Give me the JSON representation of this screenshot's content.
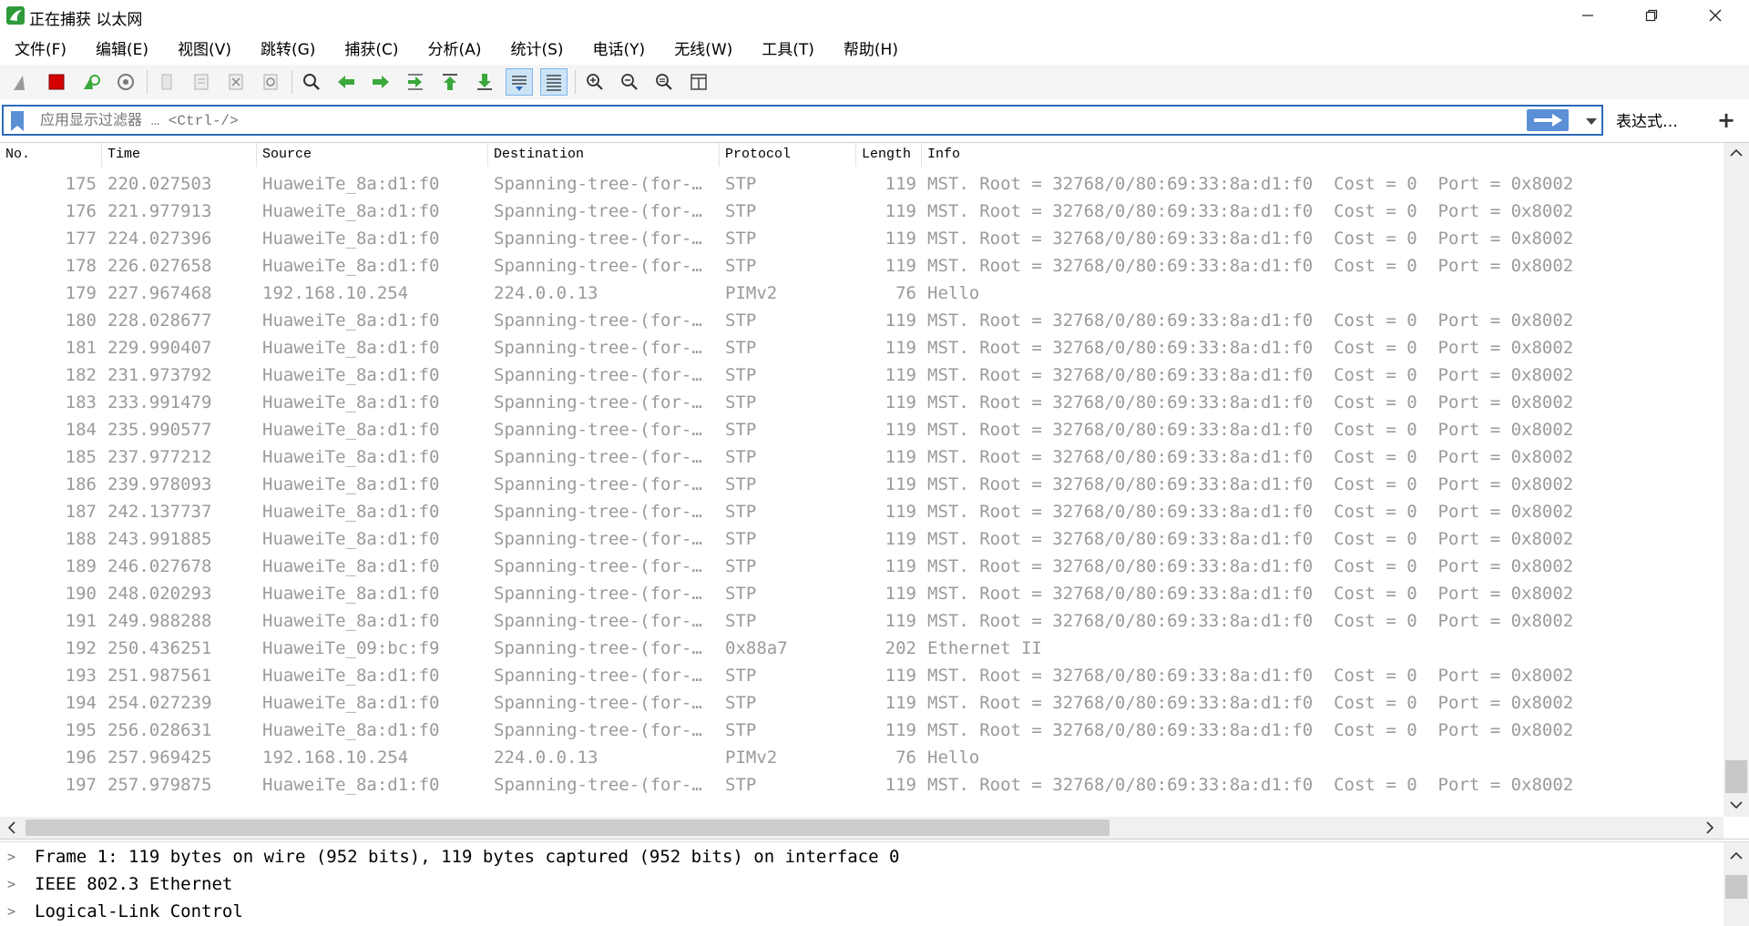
{
  "window": {
    "title": "正在捕获 以太网",
    "minimize_glyph": "—",
    "maximize_glyph": "❐",
    "close_glyph": "✕"
  },
  "menu": [
    {
      "label": "文件(F)"
    },
    {
      "label": "编辑(E)"
    },
    {
      "label": "视图(V)"
    },
    {
      "label": "跳转(G)"
    },
    {
      "label": "捕获(C)"
    },
    {
      "label": "分析(A)"
    },
    {
      "label": "统计(S)"
    },
    {
      "label": "电话(Y)"
    },
    {
      "label": "无线(W)"
    },
    {
      "label": "工具(T)"
    },
    {
      "label": "帮助(H)"
    }
  ],
  "toolbar": {
    "icons": [
      "shark-fin-icon",
      "stop-capture-icon",
      "restart-capture-icon",
      "capture-options-icon",
      "open-file-icon",
      "save-file-icon",
      "close-file-icon",
      "reload-file-icon",
      "find-packet-icon",
      "go-back-icon",
      "go-forward-icon",
      "go-to-packet-icon",
      "go-first-icon",
      "go-last-icon",
      "auto-scroll-icon",
      "colorize-icon",
      "zoom-in-icon",
      "zoom-out-icon",
      "zoom-normal-icon",
      "resize-columns-icon"
    ],
    "colors": {
      "stop": "#d40000",
      "green": "#3aa83a",
      "blue_arrow": "#5b8fd6"
    }
  },
  "filter": {
    "placeholder": "应用显示过滤器 … <Ctrl-/>",
    "value": "",
    "expression_label": "表达式…",
    "add_label": "+"
  },
  "columns": {
    "no": "No.",
    "time": "Time",
    "source": "Source",
    "destination": "Destination",
    "protocol": "Protocol",
    "length": "Length",
    "info": "Info"
  },
  "packets": [
    {
      "no": "175",
      "time": "220.027503",
      "src": "HuaweiTe_8a:d1:f0",
      "dst": "Spanning-tree-(for-…",
      "proto": "STP",
      "len": "119",
      "info": "MST. Root = 32768/0/80:69:33:8a:d1:f0  Cost = 0  Port = 0x8002"
    },
    {
      "no": "176",
      "time": "221.977913",
      "src": "HuaweiTe_8a:d1:f0",
      "dst": "Spanning-tree-(for-…",
      "proto": "STP",
      "len": "119",
      "info": "MST. Root = 32768/0/80:69:33:8a:d1:f0  Cost = 0  Port = 0x8002"
    },
    {
      "no": "177",
      "time": "224.027396",
      "src": "HuaweiTe_8a:d1:f0",
      "dst": "Spanning-tree-(for-…",
      "proto": "STP",
      "len": "119",
      "info": "MST. Root = 32768/0/80:69:33:8a:d1:f0  Cost = 0  Port = 0x8002"
    },
    {
      "no": "178",
      "time": "226.027658",
      "src": "HuaweiTe_8a:d1:f0",
      "dst": "Spanning-tree-(for-…",
      "proto": "STP",
      "len": "119",
      "info": "MST. Root = 32768/0/80:69:33:8a:d1:f0  Cost = 0  Port = 0x8002"
    },
    {
      "no": "179",
      "time": "227.967468",
      "src": "192.168.10.254",
      "dst": "224.0.0.13",
      "proto": "PIMv2",
      "len": "76",
      "info": "Hello"
    },
    {
      "no": "180",
      "time": "228.028677",
      "src": "HuaweiTe_8a:d1:f0",
      "dst": "Spanning-tree-(for-…",
      "proto": "STP",
      "len": "119",
      "info": "MST. Root = 32768/0/80:69:33:8a:d1:f0  Cost = 0  Port = 0x8002"
    },
    {
      "no": "181",
      "time": "229.990407",
      "src": "HuaweiTe_8a:d1:f0",
      "dst": "Spanning-tree-(for-…",
      "proto": "STP",
      "len": "119",
      "info": "MST. Root = 32768/0/80:69:33:8a:d1:f0  Cost = 0  Port = 0x8002"
    },
    {
      "no": "182",
      "time": "231.973792",
      "src": "HuaweiTe_8a:d1:f0",
      "dst": "Spanning-tree-(for-…",
      "proto": "STP",
      "len": "119",
      "info": "MST. Root = 32768/0/80:69:33:8a:d1:f0  Cost = 0  Port = 0x8002"
    },
    {
      "no": "183",
      "time": "233.991479",
      "src": "HuaweiTe_8a:d1:f0",
      "dst": "Spanning-tree-(for-…",
      "proto": "STP",
      "len": "119",
      "info": "MST. Root = 32768/0/80:69:33:8a:d1:f0  Cost = 0  Port = 0x8002"
    },
    {
      "no": "184",
      "time": "235.990577",
      "src": "HuaweiTe_8a:d1:f0",
      "dst": "Spanning-tree-(for-…",
      "proto": "STP",
      "len": "119",
      "info": "MST. Root = 32768/0/80:69:33:8a:d1:f0  Cost = 0  Port = 0x8002"
    },
    {
      "no": "185",
      "time": "237.977212",
      "src": "HuaweiTe_8a:d1:f0",
      "dst": "Spanning-tree-(for-…",
      "proto": "STP",
      "len": "119",
      "info": "MST. Root = 32768/0/80:69:33:8a:d1:f0  Cost = 0  Port = 0x8002"
    },
    {
      "no": "186",
      "time": "239.978093",
      "src": "HuaweiTe_8a:d1:f0",
      "dst": "Spanning-tree-(for-…",
      "proto": "STP",
      "len": "119",
      "info": "MST. Root = 32768/0/80:69:33:8a:d1:f0  Cost = 0  Port = 0x8002"
    },
    {
      "no": "187",
      "time": "242.137737",
      "src": "HuaweiTe_8a:d1:f0",
      "dst": "Spanning-tree-(for-…",
      "proto": "STP",
      "len": "119",
      "info": "MST. Root = 32768/0/80:69:33:8a:d1:f0  Cost = 0  Port = 0x8002"
    },
    {
      "no": "188",
      "time": "243.991885",
      "src": "HuaweiTe_8a:d1:f0",
      "dst": "Spanning-tree-(for-…",
      "proto": "STP",
      "len": "119",
      "info": "MST. Root = 32768/0/80:69:33:8a:d1:f0  Cost = 0  Port = 0x8002"
    },
    {
      "no": "189",
      "time": "246.027678",
      "src": "HuaweiTe_8a:d1:f0",
      "dst": "Spanning-tree-(for-…",
      "proto": "STP",
      "len": "119",
      "info": "MST. Root = 32768/0/80:69:33:8a:d1:f0  Cost = 0  Port = 0x8002"
    },
    {
      "no": "190",
      "time": "248.020293",
      "src": "HuaweiTe_8a:d1:f0",
      "dst": "Spanning-tree-(for-…",
      "proto": "STP",
      "len": "119",
      "info": "MST. Root = 32768/0/80:69:33:8a:d1:f0  Cost = 0  Port = 0x8002"
    },
    {
      "no": "191",
      "time": "249.988288",
      "src": "HuaweiTe_8a:d1:f0",
      "dst": "Spanning-tree-(for-…",
      "proto": "STP",
      "len": "119",
      "info": "MST. Root = 32768/0/80:69:33:8a:d1:f0  Cost = 0  Port = 0x8002"
    },
    {
      "no": "192",
      "time": "250.436251",
      "src": "HuaweiTe_09:bc:f9",
      "dst": "Spanning-tree-(for-…",
      "proto": "0x88a7",
      "len": "202",
      "info": "Ethernet II"
    },
    {
      "no": "193",
      "time": "251.987561",
      "src": "HuaweiTe_8a:d1:f0",
      "dst": "Spanning-tree-(for-…",
      "proto": "STP",
      "len": "119",
      "info": "MST. Root = 32768/0/80:69:33:8a:d1:f0  Cost = 0  Port = 0x8002"
    },
    {
      "no": "194",
      "time": "254.027239",
      "src": "HuaweiTe_8a:d1:f0",
      "dst": "Spanning-tree-(for-…",
      "proto": "STP",
      "len": "119",
      "info": "MST. Root = 32768/0/80:69:33:8a:d1:f0  Cost = 0  Port = 0x8002"
    },
    {
      "no": "195",
      "time": "256.028631",
      "src": "HuaweiTe_8a:d1:f0",
      "dst": "Spanning-tree-(for-…",
      "proto": "STP",
      "len": "119",
      "info": "MST. Root = 32768/0/80:69:33:8a:d1:f0  Cost = 0  Port = 0x8002"
    },
    {
      "no": "196",
      "time": "257.969425",
      "src": "192.168.10.254",
      "dst": "224.0.0.13",
      "proto": "PIMv2",
      "len": "76",
      "info": "Hello"
    },
    {
      "no": "197",
      "time": "257.979875",
      "src": "HuaweiTe_8a:d1:f0",
      "dst": "Spanning-tree-(for-…",
      "proto": "STP",
      "len": "119",
      "info": "MST. Root = 32768/0/80:69:33:8a:d1:f0  Cost = 0  Port = 0x8002"
    }
  ],
  "details": [
    {
      "text": "Frame 1: 119 bytes on wire (952 bits), 119 bytes captured (952 bits) on interface 0"
    },
    {
      "text": "IEEE 802.3 Ethernet"
    },
    {
      "text": "Logical-Link Control"
    }
  ],
  "colors": {
    "row_text": "#9a9a9a",
    "accent_border": "#2a6ab8",
    "apply_button": "#5b8fd6"
  }
}
